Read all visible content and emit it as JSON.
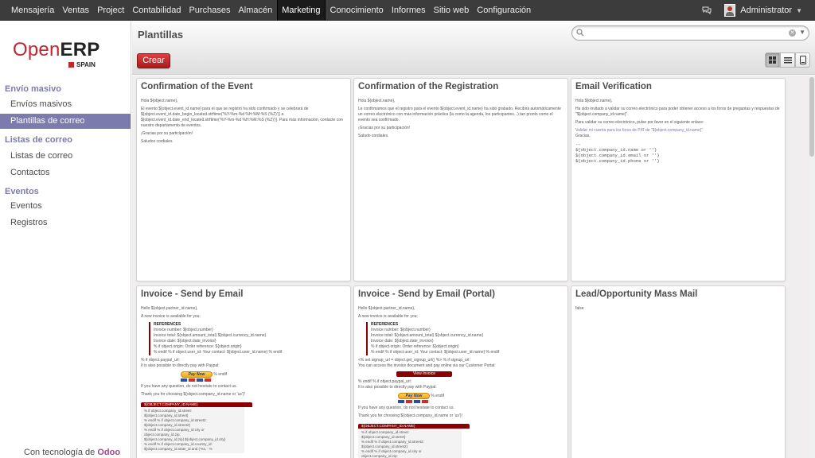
{
  "topbar": {
    "menu": [
      {
        "label": "Mensajería",
        "active": false
      },
      {
        "label": "Ventas",
        "active": false
      },
      {
        "label": "Project",
        "active": false
      },
      {
        "label": "Contabilidad",
        "active": false
      },
      {
        "label": "Purchases",
        "active": false
      },
      {
        "label": "Almacén",
        "active": false
      },
      {
        "label": "Marketing",
        "active": true
      },
      {
        "label": "Conocimiento",
        "active": false
      },
      {
        "label": "Informes",
        "active": false
      },
      {
        "label": "Sitio web",
        "active": false
      },
      {
        "label": "Configuración",
        "active": false
      }
    ],
    "user": "Administrator"
  },
  "sidebar": {
    "logo": {
      "text_open": "Open",
      "text_erp": "ERP",
      "text_spain": "SPAIN"
    },
    "sections": [
      {
        "title": "Envío masivo",
        "items": [
          {
            "label": "Envíos masivos",
            "active": false
          },
          {
            "label": "Plantillas de correo",
            "active": true
          }
        ]
      },
      {
        "title": "Listas de correo",
        "items": [
          {
            "label": "Listas de correo",
            "active": false
          },
          {
            "label": "Contactos",
            "active": false
          }
        ]
      },
      {
        "title": "Eventos",
        "items": [
          {
            "label": "Eventos",
            "active": false
          },
          {
            "label": "Registros",
            "active": false
          }
        ]
      }
    ],
    "powered_by": "Con tecnología de",
    "powered_brand": "Odoo"
  },
  "header": {
    "title": "Plantillas",
    "search_placeholder": "",
    "create_label": "Crear",
    "active_view": "kanban"
  },
  "colors": {
    "brand": "#7c7bad",
    "primary_button": "#c0272d",
    "accent_dark_red": "#8b0000"
  },
  "cards": [
    {
      "title": "Confirmation of the Event",
      "body": [
        "Hola ${object.name},",
        "El evento ${object.event_id.name} para el que se registró ha sido confirmado y se celebrará de ${object.event_id.date_begin_located.strftime('%Y-%m-%d %H:%M:%S (%Z)')} a ${object.event_id.date_end_located.strftime('%Y-%m-%d %H:%M:%S (%Z)')}. Para más información, contacte con nuestro departamento de eventos.",
        "¡Gracias por su participación!",
        "Saludos cordiales"
      ]
    },
    {
      "title": "Confirmation of the Registration",
      "body": [
        "Hola ${object.name},",
        "Le confirmamos que el registro para el evento ${object.event_id.name} ha sido grabado. Recibirá automáticamente un correo electrónico con más información práctica (la como la agenda, los participantes...) tan pronto como el evento sea confirmado.",
        "¡Gracias por su participación!",
        "Saludo cordiales."
      ]
    },
    {
      "title": "Email Verification",
      "body": [
        "Hola ${object.name},",
        "Ha sido invitado a validar su correo electrónico para poder obtener acceso a los foros de preguntas y respuestas de \"${object.company_id.name}\".",
        "Para validar su correo electrónico, pulse por favor en el siguiente enlace:"
      ],
      "link": "Validar mi cuenta para los foros de P/R de \"${object.company_id.name}\"",
      "closing": "Gracias,",
      "mono": [
        "--",
        "${object.company_id.name or ''}",
        "${object.company_id.email or ''}",
        "${object.company_id.phone or ''}"
      ]
    },
    {
      "title": "Invoice - Send by Email",
      "greeting": "Hello ${object.partner_id.name},",
      "intro": "A new invoice is available for you:",
      "references_title": "REFERENCES",
      "references": [
        "Invoice number: ${object.number}",
        "Invoice total: ${object.amount_total} ${object.currency_id.name}",
        "Invoice date: ${object.date_invoice}",
        "% if object.origin: Order reference: ${object.origin}",
        "% endif % if object.user_id: Your contact: ${object.user_id.name} % endif"
      ],
      "paypal_lines": [
        "% if object.paypal_url:",
        "It is also possible to directly pay with Paypal:"
      ],
      "paypal_label": "Pay Now",
      "paypal_endif": "% endif",
      "outro": [
        "If you have any question, do not hesitate to contact us.",
        "Thank you for choosing ${object.company_id.name or 'us'}!"
      ],
      "company_header": "${OBJECT.COMPANY_ID.NAME}",
      "company_lines": [
        "% if object.company_id.street:",
        "${object.company_id.street}",
        "% endif % if object.company_id.street2:",
        "${object.company_id.street2}",
        "% endif % if object.company_id.city or object.company_id.zip:",
        "${object.company_id.zip} ${object.company_id.city}",
        "% endif % if object.company_id.country_id:",
        "${object.company_id.state_id and ('%s, ' %"
      ]
    },
    {
      "title": "Invoice - Send by Email (Portal)",
      "greeting": "Hello ${object.partner_id.name},",
      "intro": "A new invoice is available for you:",
      "references_title": "REFERENCES",
      "references": [
        "Invoice number: ${object.number}",
        "Invoice total: ${object.amount_total} ${object.currency_id.name}",
        "Invoice date: ${object.date_invoice}",
        "% if object.origin: Order reference: ${object.origin}",
        "% endif % if object.user_id: Your contact: ${object.user_id.name} % endif"
      ],
      "portal_lines": [
        "<% set signup_url = object.get_signup_url() %> % if signup_url:",
        "You can access the invoice document and pay online via our Customer Portal:"
      ],
      "view_invoice_label": "View Invoice",
      "paypal_lines": [
        "% endif % if object.paypal_url:",
        "It is also possible to directly pay with Paypal:"
      ],
      "paypal_label": "Pay Now",
      "paypal_endif": "% endif",
      "outro": [
        "If you have any question, do not hesitate to contact us.",
        "Thank you for choosing ${object.company_id.name or 'us'}!"
      ],
      "company_header": "${OBJECT.COMPANY_ID.NAME}",
      "company_lines": [
        "% if object.company_id.street:",
        "${object.company_id.street}",
        "% endif % if object.company_id.street2:",
        "${object.company_id.street2}",
        "% endif % if object.company_id.city or object.company_id.zip:"
      ]
    },
    {
      "title": "Lead/Opportunity Mass Mail",
      "body": [
        "false"
      ]
    }
  ]
}
